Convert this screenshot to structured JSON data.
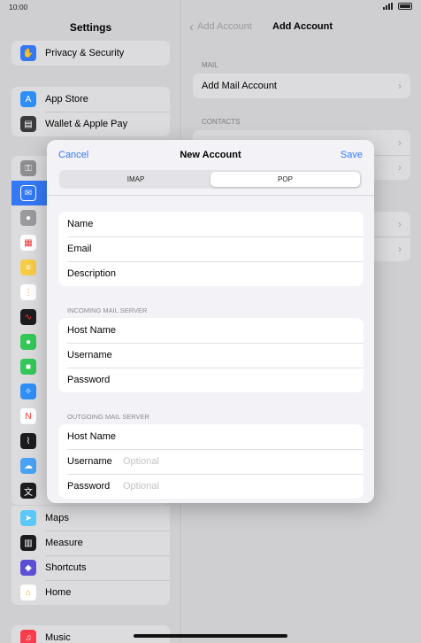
{
  "status_bar": {
    "time": "10:00"
  },
  "sidebar": {
    "title": "Settings",
    "group1": [
      {
        "label": "Privacy & Security",
        "icon": "hand-icon",
        "color": "#3478f6"
      }
    ],
    "group2": [
      {
        "label": "App Store",
        "icon": "app-store-icon",
        "color": "#2f8ff6"
      },
      {
        "label": "Wallet & Apple Pay",
        "icon": "wallet-icon",
        "color": "#3a3a3c"
      }
    ],
    "mini_icons": [
      {
        "icon": "key-icon",
        "color": "#8e8e93"
      },
      {
        "icon": "mail-icon",
        "color": "#3478f6"
      },
      {
        "icon": "contacts-icon",
        "color": "#9a9a9f"
      },
      {
        "icon": "calendar-icon",
        "color": "#ffffff"
      },
      {
        "icon": "notes-icon",
        "color": "#f7cd46"
      },
      {
        "icon": "reminders-icon",
        "color": "#ffffff"
      },
      {
        "icon": "voice-memos-icon",
        "color": "#1c1c1e"
      },
      {
        "icon": "messages-icon",
        "color": "#34c759"
      },
      {
        "icon": "facetime-icon",
        "color": "#34c759"
      },
      {
        "icon": "safari-icon",
        "color": "#2f8ff6"
      },
      {
        "icon": "news-icon",
        "color": "#ffffff"
      },
      {
        "icon": "stocks-icon",
        "color": "#1c1c1e"
      },
      {
        "icon": "weather-icon",
        "color": "#4aa3f5"
      },
      {
        "icon": "translate-icon",
        "color": "#1c1c1e"
      }
    ],
    "group3": [
      {
        "label": "Maps",
        "icon": "maps-icon",
        "color": "#5ac8fa"
      },
      {
        "label": "Measure",
        "icon": "measure-icon",
        "color": "#1c1c1e"
      },
      {
        "label": "Shortcuts",
        "icon": "shortcuts-icon",
        "color": "#5b4fd6"
      },
      {
        "label": "Home",
        "icon": "home-icon",
        "color": "#ffffff"
      }
    ],
    "group4": [
      {
        "label": "Music",
        "icon": "music-icon",
        "color": "#fa3c4c"
      }
    ]
  },
  "detail": {
    "back_label": "Add Account",
    "title": "Add Account",
    "mail_section": "MAIL",
    "mail_rows": [
      "Add Mail Account"
    ],
    "contacts_section": "CONTACTS"
  },
  "modal": {
    "cancel": "Cancel",
    "title": "New Account",
    "save": "Save",
    "segments": [
      "IMAP",
      "POP"
    ],
    "account_fields": [
      {
        "label": "Name",
        "value": ""
      },
      {
        "label": "Email",
        "value": ""
      },
      {
        "label": "Description",
        "value": ""
      }
    ],
    "incoming_header": "INCOMING MAIL SERVER",
    "incoming_fields": [
      {
        "label": "Host Name",
        "value": ""
      },
      {
        "label": "Username",
        "value": ""
      },
      {
        "label": "Password",
        "value": ""
      }
    ],
    "outgoing_header": "OUTGOING MAIL SERVER",
    "outgoing_fields": [
      {
        "label": "Host Name",
        "value": ""
      },
      {
        "label": "Username",
        "placeholder": "Optional"
      },
      {
        "label": "Password",
        "placeholder": "Optional"
      }
    ]
  },
  "colors": {
    "accent": "#3478f6"
  }
}
